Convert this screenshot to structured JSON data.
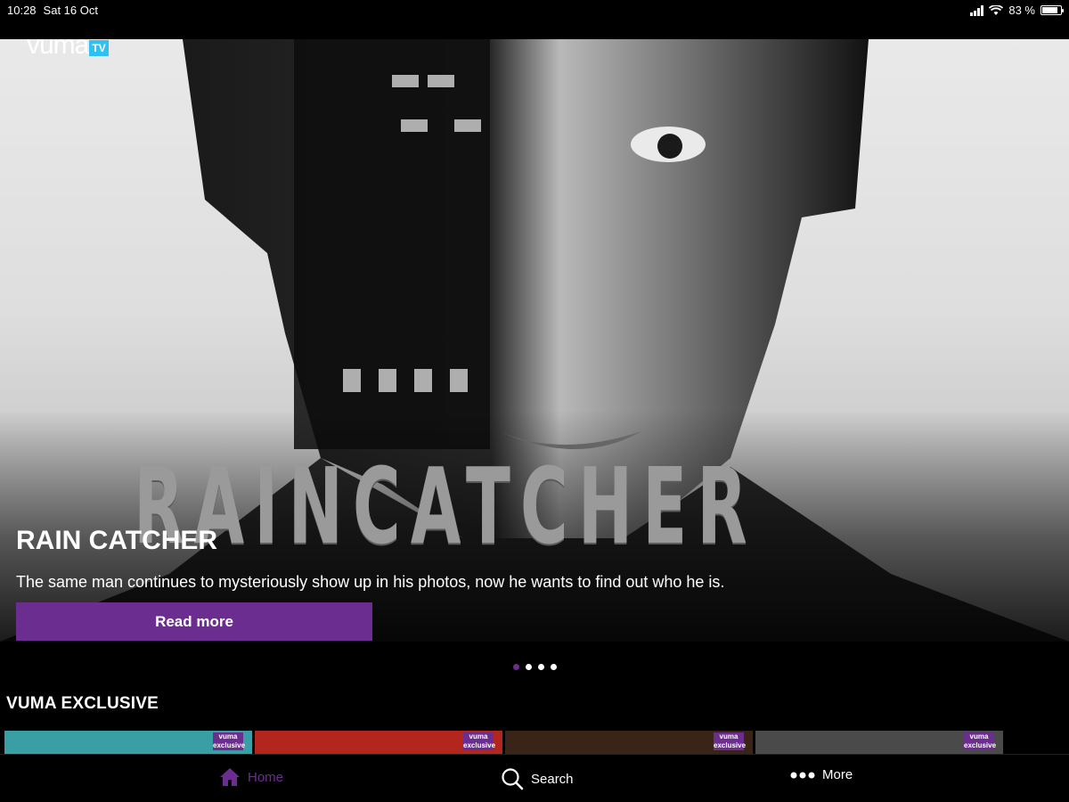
{
  "status_bar": {
    "time": "10:28",
    "date": "Sat 16 Oct",
    "battery": "83 %"
  },
  "brand": {
    "logo": "vuma",
    "logo_suffix": "TV",
    "accent_color": "#6c2d91",
    "logo_suffix_color": "#2ec1f2"
  },
  "hero": {
    "poster_title": "RAINCATCHER",
    "title": "RAIN CATCHER",
    "description": "The same man continues to mysteriously show up in his photos, now he wants to find out who he is.",
    "read_more_label": "Read more",
    "carousel": {
      "total": 4,
      "active_index": 0
    }
  },
  "section": {
    "title": "VUMA EXCLUSIVE",
    "thumbnails": [
      {
        "badge": "vuma exclusive",
        "color": "#3a9fa4"
      },
      {
        "badge": "vuma exclusive",
        "color": "#b3261e"
      },
      {
        "badge": "vuma exclusive",
        "color": "#3a2418"
      },
      {
        "badge": "vuma exclusive",
        "color": "#4a4a4a"
      }
    ]
  },
  "tabbar": {
    "items": [
      {
        "label": "Home",
        "icon": "home-icon",
        "active": true
      },
      {
        "label": "Search",
        "icon": "search-icon",
        "active": false
      },
      {
        "label": "More",
        "icon": "more-dots-icon",
        "active": false
      }
    ]
  }
}
